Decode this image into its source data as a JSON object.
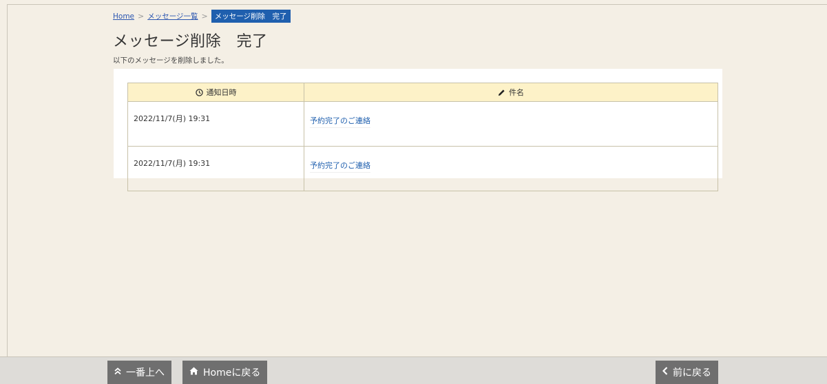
{
  "breadcrumb": {
    "home": "Home",
    "list": "メッセージ一覧",
    "current": "メッセージ削除　完了"
  },
  "page": {
    "title": "メッセージ削除　完了",
    "description": "以下のメッセージを削除しました。"
  },
  "table": {
    "columns": [
      "通知日時",
      "件名"
    ],
    "rows": [
      {
        "date": "2022/11/7(月) 19:31",
        "subject": "予約完了のご連絡"
      },
      {
        "date": "2022/11/7(月) 19:31",
        "subject": "予約完了のご連絡"
      }
    ]
  },
  "footer": {
    "top_label": "一番上へ",
    "home_label": "Homeに戻る",
    "back_label": "前に戻る"
  },
  "icons": {
    "clock": "clock-icon",
    "pencil": "pencil-icon",
    "chevron_up_double": "double-chevron-up-icon",
    "home": "home-icon",
    "chevron_left": "chevron-left-icon"
  },
  "colors": {
    "background": "#f4efe5",
    "breadcrumb_current": "#1f5fae",
    "table_header": "#fdf2c8",
    "footer_button": "#6f6f6f"
  }
}
